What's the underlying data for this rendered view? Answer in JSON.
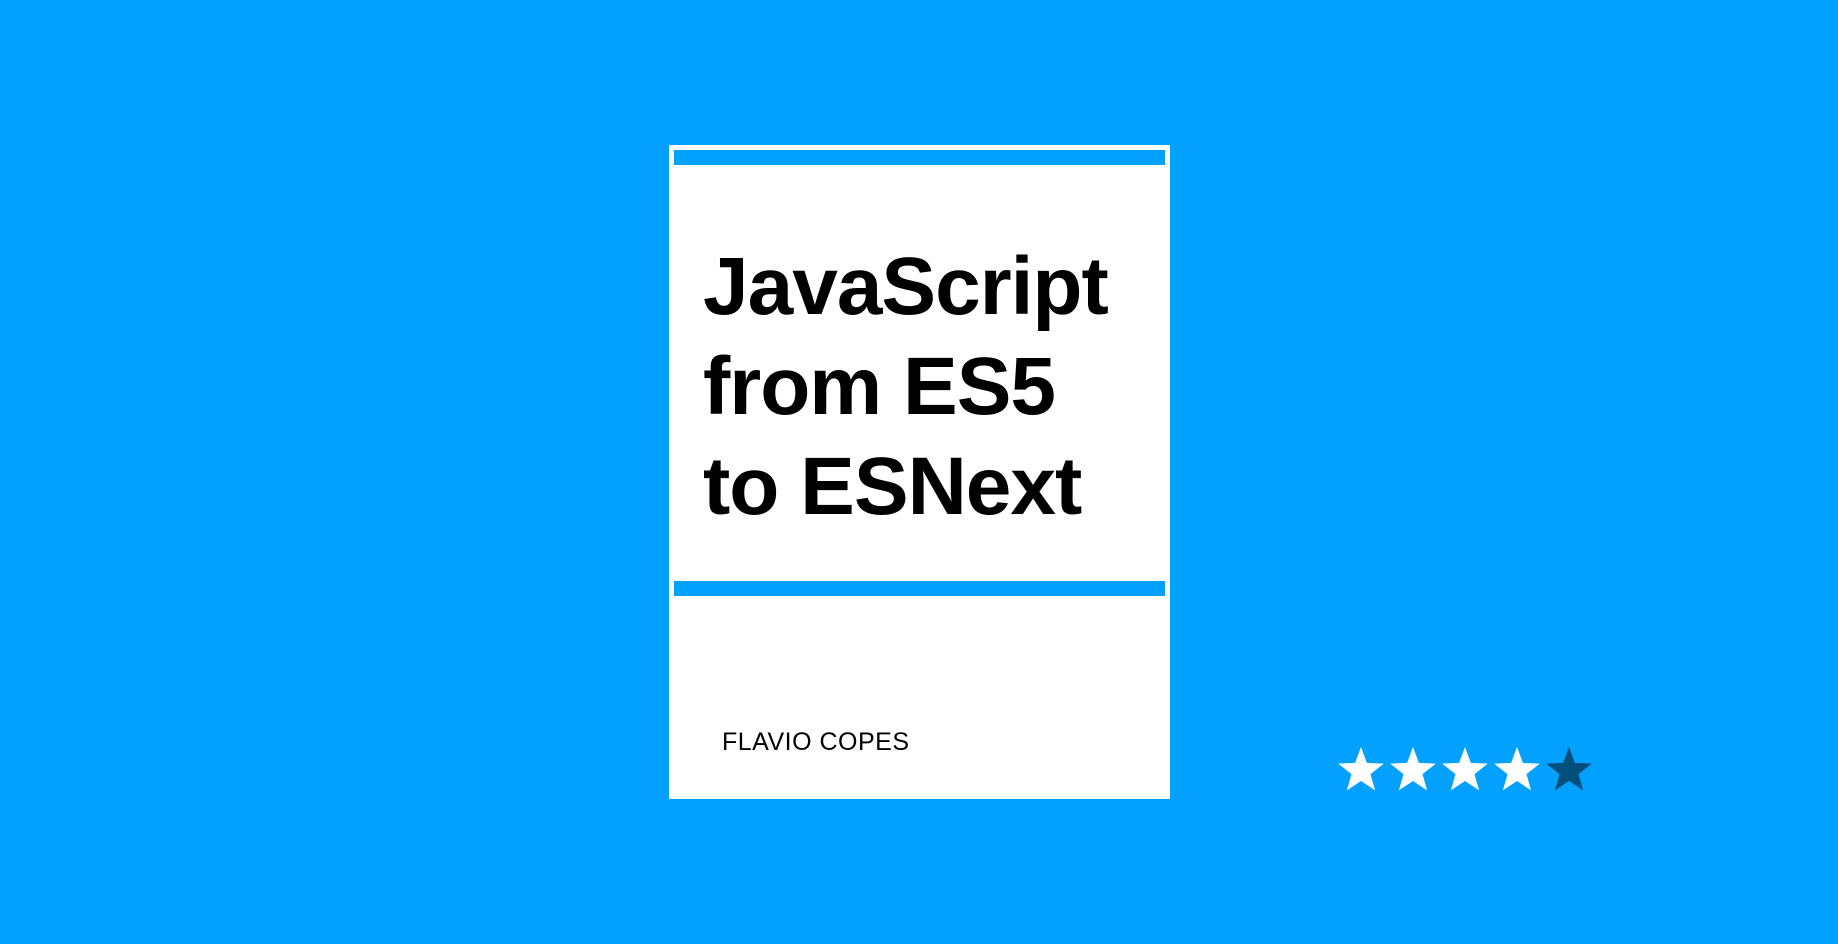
{
  "book": {
    "title_lines": [
      "JavaScript",
      "from ES5",
      "to ESNext"
    ],
    "author": "FLAVIO COPES"
  },
  "rating": {
    "value": 4,
    "max": 5,
    "filled_color": "#ffffff",
    "empty_color": "#034f7c",
    "icon": "star-icon"
  },
  "colors": {
    "background": "#03a1ff",
    "cover": "#ffffff",
    "accent_bar": "#03a1ff",
    "text": "#000000"
  }
}
